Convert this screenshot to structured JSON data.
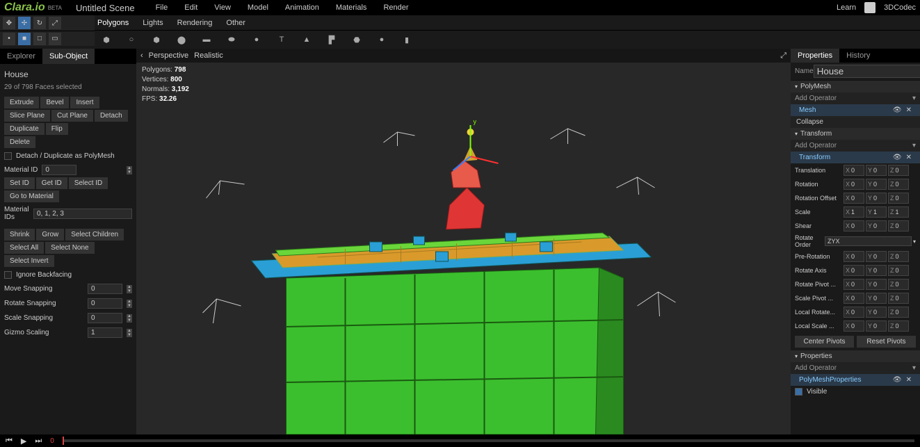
{
  "app": {
    "logo": "Clara.io",
    "beta": "BETA",
    "scene": "Untitled Scene"
  },
  "menu": [
    "File",
    "Edit",
    "View",
    "Model",
    "Animation",
    "Materials",
    "Render"
  ],
  "topright": {
    "learn": "Learn",
    "user": "3DCodec"
  },
  "subtabs": [
    "Polygons",
    "Lights",
    "Rendering",
    "Other"
  ],
  "left_tabs": [
    "Explorer",
    "Sub-Object"
  ],
  "selection": {
    "name": "House",
    "info": "29 of 798 Faces selected"
  },
  "left": {
    "row1": [
      "Extrude",
      "Bevel",
      "Insert"
    ],
    "row2": [
      "Slice Plane",
      "Cut Plane",
      "Detach"
    ],
    "row3": [
      "Duplicate",
      "Flip"
    ],
    "row4": [
      "Delete"
    ],
    "chk_detach": "Detach / Duplicate as PolyMesh",
    "material_id_lbl": "Material ID",
    "material_id_val": "0",
    "row5": [
      "Set ID",
      "Get ID",
      "Select ID"
    ],
    "row6": [
      "Go to Material"
    ],
    "material_ids_lbl": "Material IDs",
    "material_ids_val": "0, 1, 2, 3",
    "row7": [
      "Shrink",
      "Grow",
      "Select Children"
    ],
    "row8": [
      "Select All",
      "Select None"
    ],
    "row9": [
      "Select Invert"
    ],
    "chk_backface": "Ignore Backfacing",
    "snap": [
      {
        "lbl": "Move Snapping",
        "v": "0"
      },
      {
        "lbl": "Rotate Snapping",
        "v": "0"
      },
      {
        "lbl": "Scale Snapping",
        "v": "0"
      },
      {
        "lbl": "Gizmo Scaling",
        "v": "1"
      }
    ]
  },
  "viewport": {
    "mode": "Perspective",
    "shade": "Realistic",
    "stats": {
      "poly_l": "Polygons:",
      "poly_v": "798",
      "vert_l": "Vertices:",
      "vert_v": "800",
      "norm_l": "Normals:",
      "norm_v": "3,192",
      "fps_l": "FPS:",
      "fps_v": "32.26"
    }
  },
  "right_tabs": [
    "Properties",
    "History"
  ],
  "props": {
    "name_lbl": "Name",
    "name_val": "House",
    "sections": {
      "polymesh": "PolyMesh",
      "transform": "Transform",
      "properties": "Properties"
    },
    "add_op": "Add Operator",
    "mesh": "Mesh",
    "collapse": "Collapse",
    "transform_op": "Transform",
    "xyz": [
      {
        "lbl": "Translation",
        "x": "0",
        "y": "0",
        "z": "0"
      },
      {
        "lbl": "Rotation",
        "x": "0",
        "y": "0",
        "z": "0"
      },
      {
        "lbl": "Rotation Offset",
        "x": "0",
        "y": "0",
        "z": "0"
      },
      {
        "lbl": "Scale",
        "x": "1",
        "y": "1",
        "z": "1"
      },
      {
        "lbl": "Shear",
        "x": "0",
        "y": "0",
        "z": "0"
      }
    ],
    "rotate_order_lbl": "Rotate Order",
    "rotate_order_val": "ZYX",
    "xyz2": [
      {
        "lbl": "Pre-Rotation",
        "x": "0",
        "y": "0",
        "z": "0"
      },
      {
        "lbl": "Rotate Axis",
        "x": "0",
        "y": "0",
        "z": "0"
      },
      {
        "lbl": "Rotate Pivot ...",
        "x": "0",
        "y": "0",
        "z": "0"
      },
      {
        "lbl": "Scale Pivot ...",
        "x": "0",
        "y": "0",
        "z": "0"
      },
      {
        "lbl": "Local Rotate...",
        "x": "0",
        "y": "0",
        "z": "0"
      },
      {
        "lbl": "Local Scale ...",
        "x": "0",
        "y": "0",
        "z": "0"
      }
    ],
    "center_pivots": "Center Pivots",
    "reset_pivots": "Reset Pivots",
    "polymesh_props": "PolyMeshProperties",
    "visible": "Visible"
  },
  "timeline": {
    "frame": "0"
  }
}
